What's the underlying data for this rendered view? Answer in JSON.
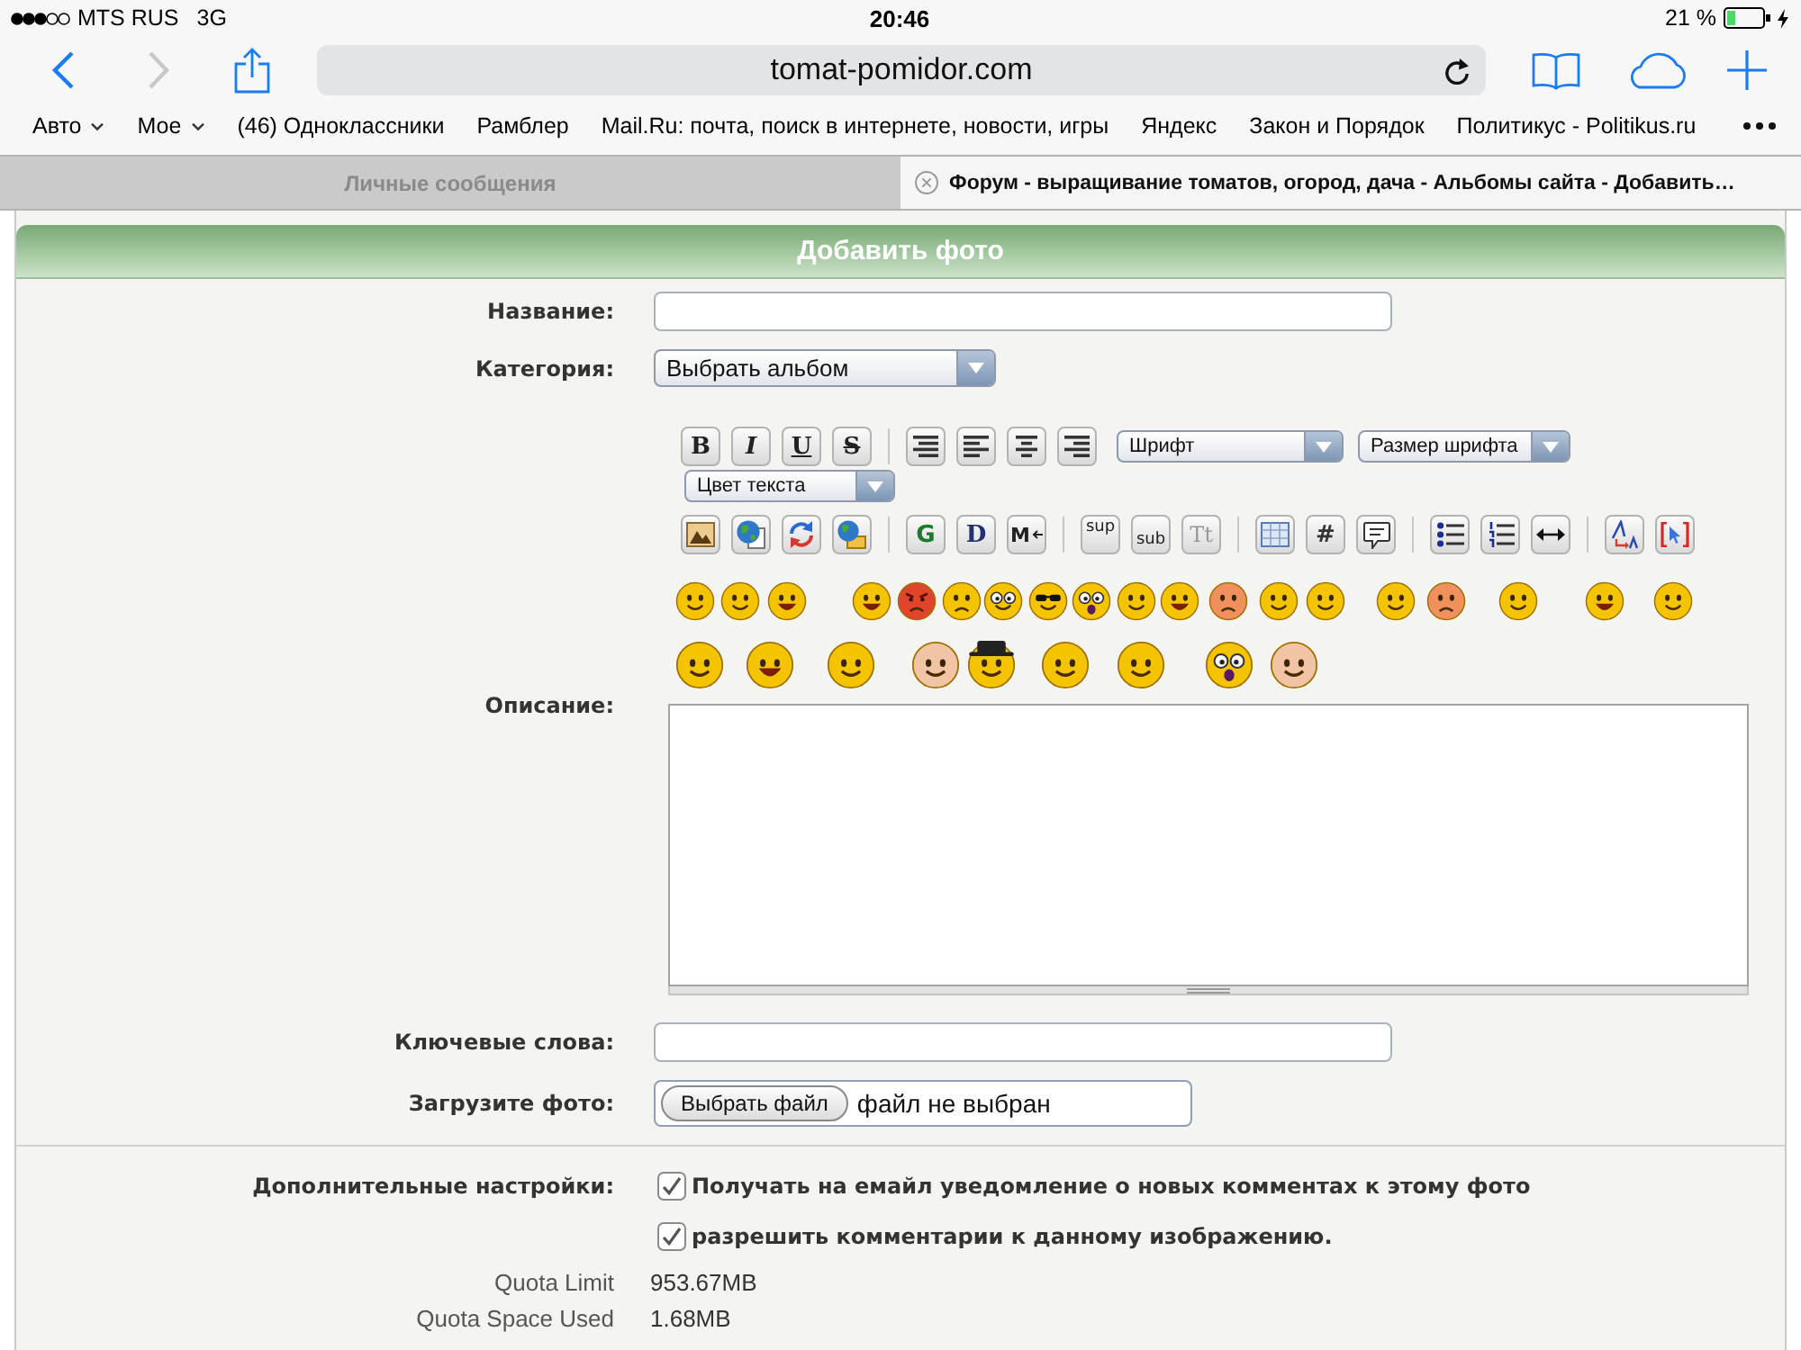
{
  "status_bar": {
    "carrier": "MTS RUS",
    "network": "3G",
    "time": "20:46",
    "battery": "21 %"
  },
  "browser_toolbar": {
    "back": {
      "disabled": false
    },
    "forward": {
      "disabled": true
    },
    "url": "tomat-pomidor.com"
  },
  "bookmarks": [
    {
      "label": "Авто",
      "menu": true
    },
    {
      "label": "Мое",
      "menu": true
    },
    {
      "label": "(46) Одноклассники",
      "menu": false
    },
    {
      "label": "Рамблер",
      "menu": false
    },
    {
      "label": "Mail.Ru: почта, поиск в интернете, новости, игры",
      "menu": false
    },
    {
      "label": "Яндекс",
      "menu": false
    },
    {
      "label": "Закон и Порядок",
      "menu": false
    },
    {
      "label": "Политикус - Politikus.ru",
      "menu": false
    }
  ],
  "tabs": [
    {
      "label": "Личные сообщения",
      "selected": false
    },
    {
      "label": "Форум - выращивание томатов, огород, дача - Альбомы сайта - Добавить…",
      "selected": true
    }
  ],
  "form": {
    "title": "Добавить фото",
    "rows": [
      {
        "kind": "text",
        "label": "Название:"
      },
      {
        "kind": "select",
        "label": "Категория:",
        "value": "Выбрать альбом"
      },
      {
        "kind": "editor",
        "label": "Описание:",
        "editor": {
          "format_buttons": [
            "B",
            "I",
            "U",
            "S"
          ],
          "font_select": "Шрифт",
          "size_select": "Размер шрифта",
          "color_select": "Цвет текста",
          "letter_buttons": [
            "G",
            "D",
            "M"
          ],
          "script_buttons": [
            "sup",
            "sub",
            "Tt"
          ],
          "symbol_button": "#"
        }
      },
      {
        "kind": "text",
        "label": "Ключевые слова:"
      },
      {
        "kind": "file",
        "label": "Загрузите фото:",
        "button": "Выбрать файл",
        "status": "файл не выбран"
      },
      {
        "kind": "checkboxes",
        "label": "Дополнительные настройки:",
        "options": [
          {
            "label": "Получать на емайл уведомление о новых комментах к этому фото",
            "checked": true
          },
          {
            "label": "разрешить комментарии к данному изображению.",
            "checked": true
          }
        ]
      },
      {
        "kind": "info",
        "label": "Quota Limit",
        "value": "953.67MB"
      },
      {
        "kind": "info",
        "label": "Quota Space Used",
        "value": "1.68MB"
      }
    ]
  }
}
